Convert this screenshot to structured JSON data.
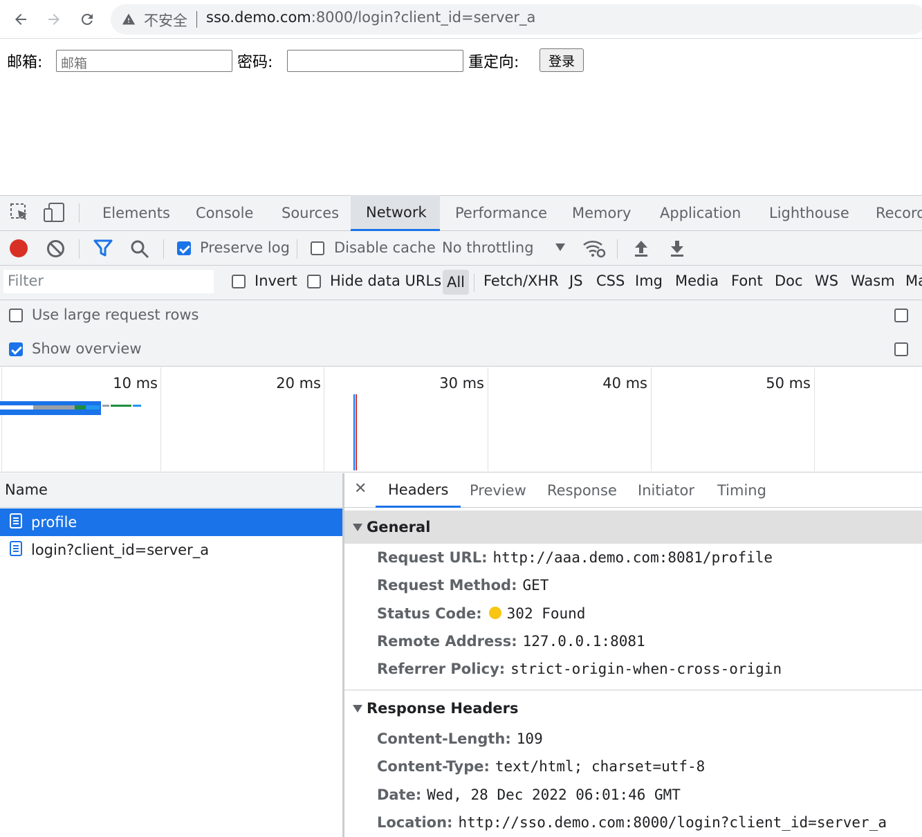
{
  "browser": {
    "security_label": "不安全",
    "url_host": "sso.demo.com",
    "url_rest": ":8000/login?client_id=server_a"
  },
  "form": {
    "email_label": "邮箱:",
    "email_placeholder": "邮箱",
    "password_label": "密码:",
    "redirect_label": "重定向:",
    "login_button": "登录"
  },
  "devtools": {
    "tabs": [
      "Elements",
      "Console",
      "Sources",
      "Network",
      "Performance",
      "Memory",
      "Application",
      "Lighthouse",
      "Record"
    ],
    "active_tab": "Network",
    "toolbar": {
      "preserve_log": "Preserve log",
      "disable_cache": "Disable cache",
      "throttling": "No throttling"
    },
    "filter": {
      "placeholder": "Filter",
      "invert": "Invert",
      "hide_data_urls": "Hide data URLs",
      "types": [
        "All",
        "Fetch/XHR",
        "JS",
        "CSS",
        "Img",
        "Media",
        "Font",
        "Doc",
        "WS",
        "Wasm",
        "Ma"
      ]
    },
    "settings": {
      "large_rows": "Use large request rows",
      "show_overview": "Show overview"
    },
    "overview_ticks": [
      "10 ms",
      "20 ms",
      "30 ms",
      "40 ms",
      "50 ms"
    ],
    "requests": {
      "column": "Name",
      "rows": [
        {
          "name": "profile",
          "selected": true
        },
        {
          "name": "login?client_id=server_a",
          "selected": false
        }
      ]
    },
    "detail": {
      "tabs": [
        "Headers",
        "Preview",
        "Response",
        "Initiator",
        "Timing"
      ],
      "general_title": "General",
      "general": [
        {
          "key": "Request URL:",
          "value": "http://aaa.demo.com:8081/profile"
        },
        {
          "key": "Request Method:",
          "value": "GET"
        },
        {
          "key": "Status Code:",
          "value": "302 Found"
        },
        {
          "key": "Remote Address:",
          "value": "127.0.0.1:8081"
        },
        {
          "key": "Referrer Policy:",
          "value": "strict-origin-when-cross-origin"
        }
      ],
      "response_title": "Response Headers",
      "response": [
        {
          "key": "Content-Length:",
          "value": "109"
        },
        {
          "key": "Content-Type:",
          "value": "text/html; charset=utf-8"
        },
        {
          "key": "Date:",
          "value": "Wed, 28 Dec 2022 06:01:46 GMT"
        },
        {
          "key": "Location:",
          "value": "http://sso.demo.com:8000/login?client_id=server_a"
        }
      ]
    }
  },
  "colors": {
    "accent": "#1a73e8",
    "record": "#d93025",
    "status_dot": "#f9c513"
  }
}
